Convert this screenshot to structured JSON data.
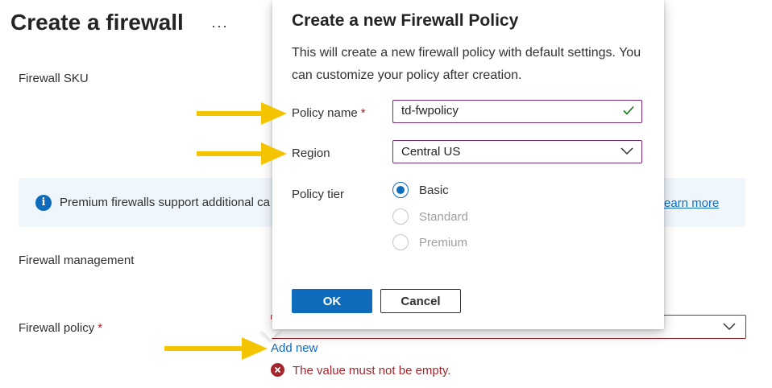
{
  "page": {
    "title": "Create a firewall",
    "more_label": "···"
  },
  "form": {
    "sku_label": "Firewall SKU",
    "info_text": "Premium firewalls support additional ca",
    "learn_more": "earn more",
    "management_label": "Firewall management",
    "policy_label": "Firewall policy",
    "required_mark": "*",
    "add_new": "Add new",
    "error_text": "The value must not be empty."
  },
  "dialog": {
    "title": "Create a new Firewall Policy",
    "description": "This will create a new firewall policy with default settings. You can customize your policy after creation.",
    "policy_name_label": "Policy name",
    "required_mark": "*",
    "policy_name_value": "td-fwpolicy",
    "region_label": "Region",
    "region_value": "Central US",
    "tier_label": "Policy tier",
    "tiers": [
      {
        "label": "Basic",
        "checked": true,
        "disabled": false
      },
      {
        "label": "Standard",
        "checked": false,
        "disabled": true
      },
      {
        "label": "Premium",
        "checked": false,
        "disabled": true
      }
    ],
    "ok_label": "OK",
    "cancel_label": "Cancel"
  },
  "colors": {
    "accent": "#0f6cbd",
    "error": "#a4262c",
    "focus_border": "#7a2a7a",
    "arrow": "#f5c400",
    "info_bg": "#eff6fc"
  },
  "icons": {
    "info": "info-icon",
    "error": "error-icon",
    "check": "check-icon",
    "chevron": "chevron-down-icon",
    "arrow": "arrow-right-icon"
  }
}
